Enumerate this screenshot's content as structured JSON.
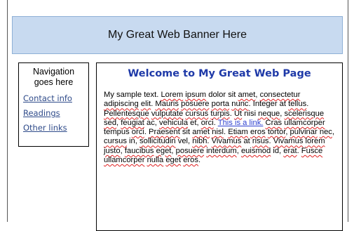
{
  "banner": {
    "text": "My Great Web Banner Here"
  },
  "nav": {
    "title_line1": "Navigation",
    "title_line2": "goes here",
    "links": [
      {
        "label": "Contact info"
      },
      {
        "label": "Readings"
      },
      {
        "label": "Other links"
      }
    ]
  },
  "main": {
    "title": "Welcome to My Great Web Page",
    "body_segments": [
      {
        "text": "My sample text. "
      },
      {
        "text": "Lorem",
        "spell": true
      },
      {
        "text": " "
      },
      {
        "text": "ipsum",
        "spell": true
      },
      {
        "text": " dolor sit "
      },
      {
        "text": "amet",
        "spell": true
      },
      {
        "text": ", "
      },
      {
        "text": "consectetur",
        "spell": true
      },
      {
        "text": " "
      },
      {
        "text": "adipiscing",
        "spell": true
      },
      {
        "text": " "
      },
      {
        "text": "elit",
        "spell": true
      },
      {
        "text": ". "
      },
      {
        "text": "Mauris",
        "spell": true
      },
      {
        "text": " "
      },
      {
        "text": "posuere",
        "spell": true
      },
      {
        "text": " "
      },
      {
        "text": "porta",
        "spell": true
      },
      {
        "text": " "
      },
      {
        "text": "nunc",
        "spell": true
      },
      {
        "text": ". Integer at "
      },
      {
        "text": "tellus",
        "spell": true
      },
      {
        "text": ". "
      },
      {
        "text": "Pellentesque",
        "spell": true
      },
      {
        "text": " "
      },
      {
        "text": "vulputate",
        "spell": true
      },
      {
        "text": " "
      },
      {
        "text": "cursus",
        "spell": true
      },
      {
        "text": " "
      },
      {
        "text": "turpis",
        "spell": true
      },
      {
        "text": ". "
      },
      {
        "text": "Ut",
        "spell": true
      },
      {
        "text": " nisi "
      },
      {
        "text": "neque",
        "spell": true
      },
      {
        "text": ", "
      },
      {
        "text": "scelerisque",
        "spell": true
      },
      {
        "text": " "
      },
      {
        "text": "sed",
        "spell": true
      },
      {
        "text": ", "
      },
      {
        "text": "feugiat",
        "spell": true
      },
      {
        "text": " ac, "
      },
      {
        "text": "vehicula",
        "spell": true
      },
      {
        "text": " et, "
      },
      {
        "text": "orci",
        "spell": true
      },
      {
        "text": ". "
      },
      {
        "text": "This is a link.",
        "link": true
      },
      {
        "text": " "
      },
      {
        "text": "Cras",
        "spell": true
      },
      {
        "text": " "
      },
      {
        "text": "ullamcorper",
        "spell": true
      },
      {
        "text": " tempus "
      },
      {
        "text": "orci",
        "spell": true
      },
      {
        "text": ". "
      },
      {
        "text": "Praesent",
        "spell": true
      },
      {
        "text": " sit "
      },
      {
        "text": "amet",
        "spell": true
      },
      {
        "text": " "
      },
      {
        "text": "nisl",
        "spell": true
      },
      {
        "text": ". "
      },
      {
        "text": "Etiam",
        "spell": true
      },
      {
        "text": " "
      },
      {
        "text": "eros",
        "spell": true
      },
      {
        "text": " "
      },
      {
        "text": "tortor",
        "spell": true
      },
      {
        "text": ", "
      },
      {
        "text": "pulvinar",
        "spell": true
      },
      {
        "text": " "
      },
      {
        "text": "nec",
        "spell": true
      },
      {
        "text": ", "
      },
      {
        "text": "cursus",
        "spell": true
      },
      {
        "text": " in, "
      },
      {
        "text": "sollicitudin",
        "spell": true
      },
      {
        "text": " vel, "
      },
      {
        "text": "nibh",
        "spell": true
      },
      {
        "text": ". "
      },
      {
        "text": "Vivamus",
        "spell": true
      },
      {
        "text": " at "
      },
      {
        "text": "risus",
        "spell": true
      },
      {
        "text": ". "
      },
      {
        "text": "Vivamus",
        "spell": true
      },
      {
        "text": " "
      },
      {
        "text": "lorem",
        "spell": true
      },
      {
        "text": " "
      },
      {
        "text": "justo",
        "spell": true
      },
      {
        "text": ", "
      },
      {
        "text": "faucibus",
        "spell": true
      },
      {
        "text": " "
      },
      {
        "text": "eget",
        "spell": true
      },
      {
        "text": ", "
      },
      {
        "text": "posuere",
        "spell": true
      },
      {
        "text": " "
      },
      {
        "text": "interdum",
        "spell": true
      },
      {
        "text": ", "
      },
      {
        "text": "euismod",
        "spell": true
      },
      {
        "text": " id, "
      },
      {
        "text": "erat",
        "spell": true
      },
      {
        "text": ". "
      },
      {
        "text": "Fusce",
        "spell": true
      },
      {
        "text": " "
      },
      {
        "text": "ullamcorper",
        "spell": true
      },
      {
        "text": " "
      },
      {
        "text": "nulla",
        "spell": true
      },
      {
        "text": " "
      },
      {
        "text": "eget",
        "spell": true
      },
      {
        "text": " "
      },
      {
        "text": "eros",
        "spell": true
      },
      {
        "text": "."
      }
    ]
  },
  "colors": {
    "banner_bg": "#c8daf0",
    "banner_border": "#8eb0d6",
    "title_blue": "#1f3aa8",
    "nav_link": "#2f4b8a",
    "inline_link": "#2b3fd0",
    "spellcheck_underline": "#e02020"
  }
}
